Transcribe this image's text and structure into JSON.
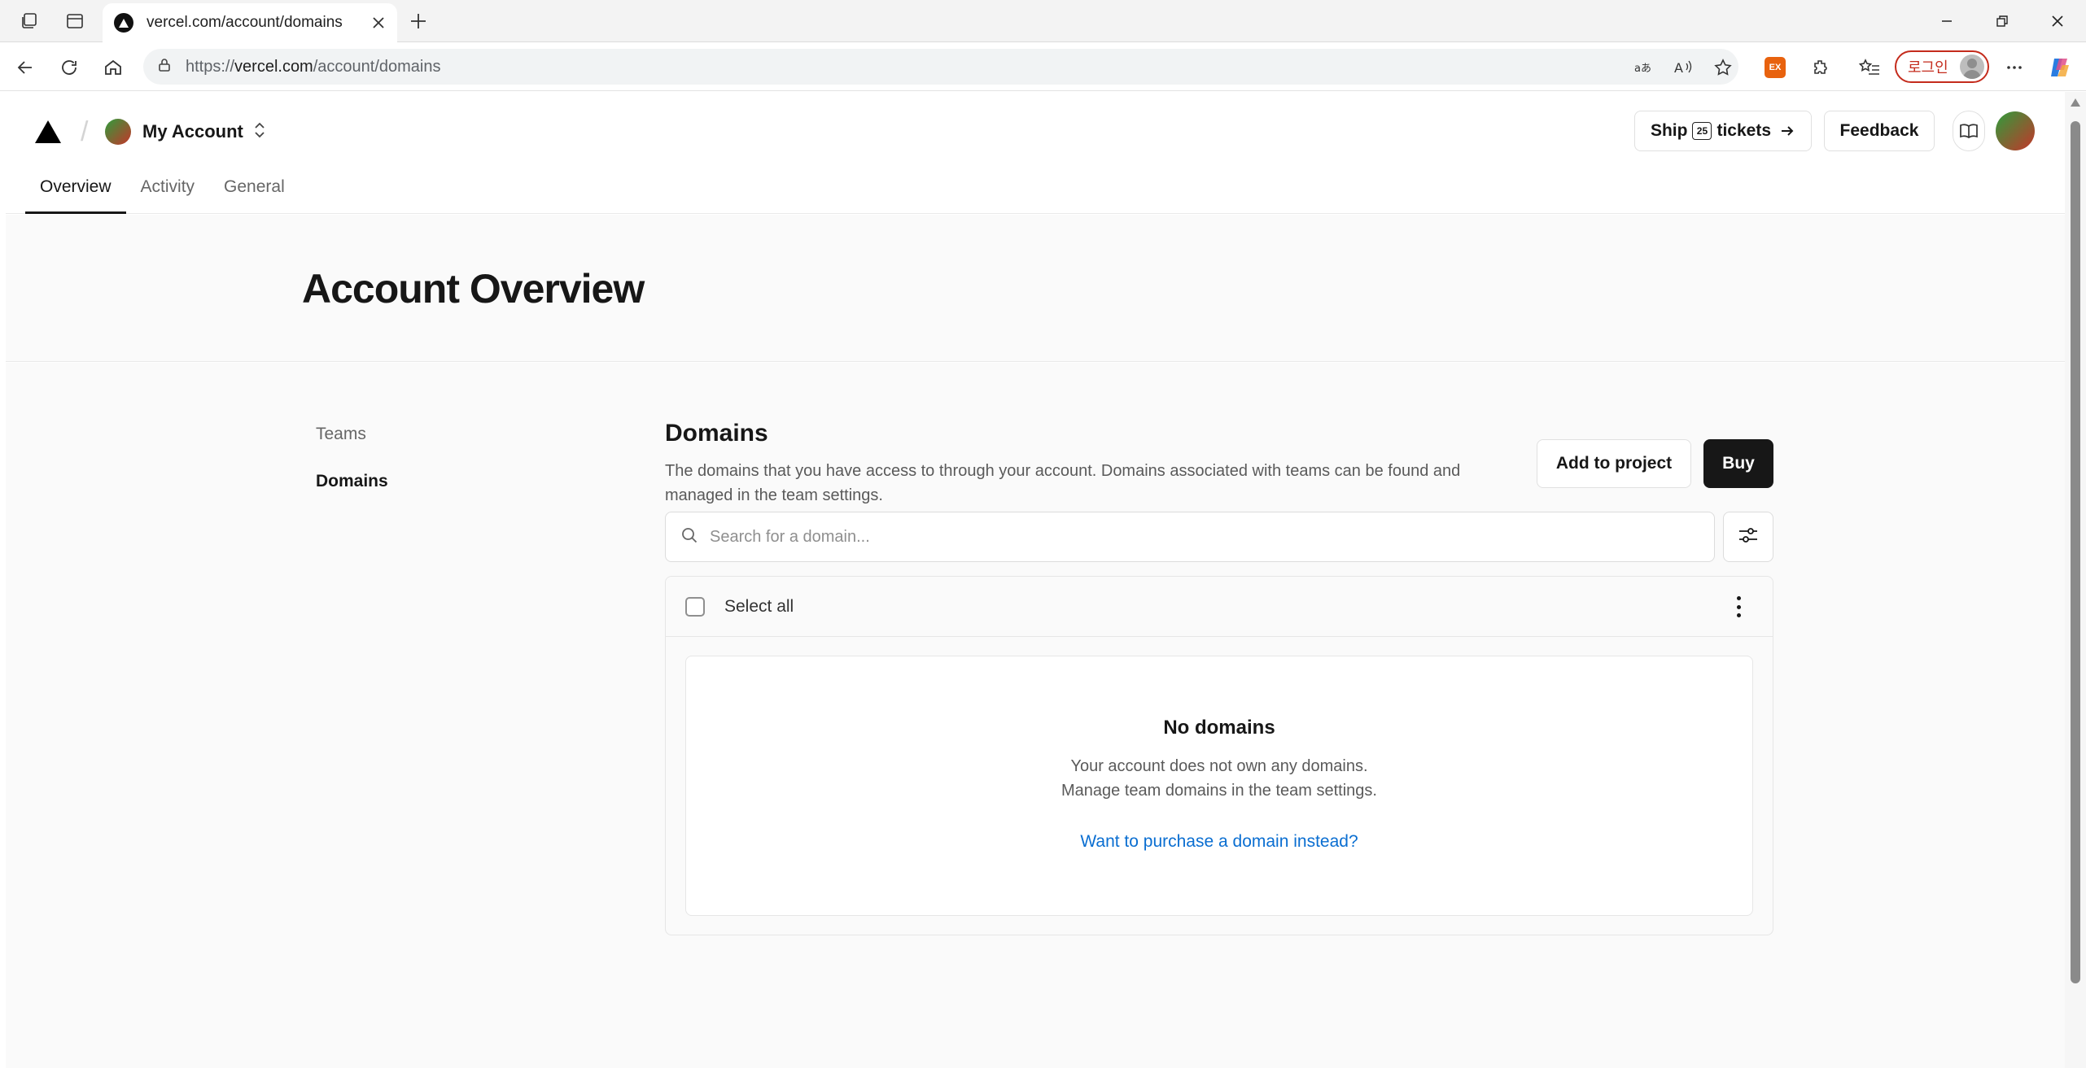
{
  "browser": {
    "tab_title": "vercel.com/account/domains",
    "url_prefix": "https://",
    "url_host": "vercel.com",
    "url_path": "/account/domains",
    "profile_label": "로그인",
    "extension_badge": "EX"
  },
  "header": {
    "account_name": "My Account",
    "ship_label_pre": "Ship",
    "ship_badge": "25",
    "ship_label_post": "tickets",
    "feedback_label": "Feedback"
  },
  "tabs": [
    {
      "label": "Overview",
      "active": true
    },
    {
      "label": "Activity",
      "active": false
    },
    {
      "label": "General",
      "active": false
    }
  ],
  "page_title": "Account Overview",
  "sidebar": {
    "items": [
      {
        "label": "Teams",
        "active": false
      },
      {
        "label": "Domains",
        "active": true
      }
    ]
  },
  "domains": {
    "title": "Domains",
    "description": "The domains that you have access to through your account. Domains associated with teams can be found and managed in the team settings.",
    "add_to_project_label": "Add to project",
    "buy_label": "Buy",
    "search_placeholder": "Search for a domain...",
    "select_all_label": "Select all",
    "empty_title": "No domains",
    "empty_line1": "Your account does not own any domains.",
    "empty_line2": "Manage team domains in the team settings.",
    "purchase_link": "Want to purchase a domain instead?"
  },
  "colors": {
    "primary_button": "#171717",
    "link": "#0a6ed1",
    "profile_pill": "#c42b1c"
  }
}
